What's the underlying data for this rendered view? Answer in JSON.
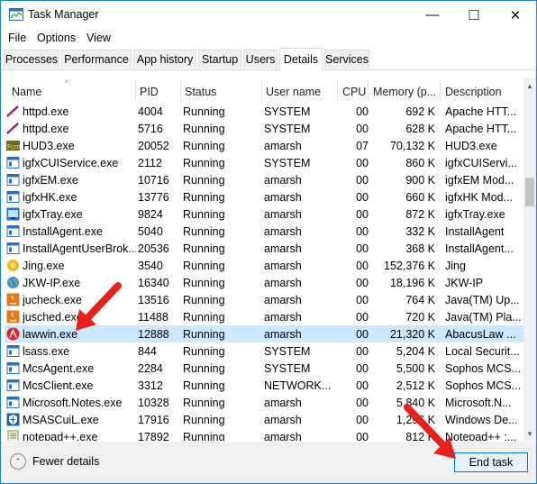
{
  "window": {
    "title": "Task Manager",
    "minimize_glyph": "—",
    "maximize_glyph": "☐",
    "close_glyph": "✕"
  },
  "menu": [
    "File",
    "Options",
    "View"
  ],
  "tabs": [
    "Processes",
    "Performance",
    "App history",
    "Startup",
    "Users",
    "Details",
    "Services"
  ],
  "active_tab": "Details",
  "columns": [
    "Name",
    "PID",
    "Status",
    "User name",
    "CPU",
    "Memory (p...",
    "Description"
  ],
  "sort_indicator": "^",
  "rows": [
    {
      "name": "httpd.exe",
      "pid": "4004",
      "status": "Running",
      "user": "SYSTEM",
      "cpu": "00",
      "mem": "692 K",
      "desc": "Apache HTT...",
      "icon": "feather-icon"
    },
    {
      "name": "httpd.exe",
      "pid": "5716",
      "status": "Running",
      "user": "SYSTEM",
      "cpu": "00",
      "mem": "628 K",
      "desc": "Apache HTT...",
      "icon": "feather-icon"
    },
    {
      "name": "HUD3.exe",
      "pid": "20052",
      "status": "Running",
      "user": "amarsh",
      "cpu": "07",
      "mem": "70,132 K",
      "desc": "HUD3.exe",
      "icon": "fcm-icon"
    },
    {
      "name": "igfxCUIService.exe",
      "pid": "2112",
      "status": "Running",
      "user": "SYSTEM",
      "cpu": "00",
      "mem": "860 K",
      "desc": "igfxCUIServi...",
      "icon": "app-window-icon"
    },
    {
      "name": "igfxEM.exe",
      "pid": "10716",
      "status": "Running",
      "user": "amarsh",
      "cpu": "00",
      "mem": "900 K",
      "desc": "igfxEM Mod...",
      "icon": "app-window-icon"
    },
    {
      "name": "igfxHK.exe",
      "pid": "13776",
      "status": "Running",
      "user": "amarsh",
      "cpu": "00",
      "mem": "660 K",
      "desc": "igfxHK Mod...",
      "icon": "app-window-icon"
    },
    {
      "name": "igfxTray.exe",
      "pid": "9824",
      "status": "Running",
      "user": "amarsh",
      "cpu": "00",
      "mem": "872 K",
      "desc": "igfxTray.exe",
      "icon": "intel-tray-icon"
    },
    {
      "name": "InstallAgent.exe",
      "pid": "5040",
      "status": "Running",
      "user": "amarsh",
      "cpu": "00",
      "mem": "332 K",
      "desc": "InstallAgent",
      "icon": "app-window-icon"
    },
    {
      "name": "InstallAgentUserBrok...",
      "pid": "20536",
      "status": "Running",
      "user": "amarsh",
      "cpu": "00",
      "mem": "368 K",
      "desc": "InstallAgent...",
      "icon": "app-window-icon"
    },
    {
      "name": "Jing.exe",
      "pid": "3540",
      "status": "Running",
      "user": "amarsh",
      "cpu": "00",
      "mem": "152,376 K",
      "desc": "Jing",
      "icon": "jing-sun-icon"
    },
    {
      "name": "JKW-IP.exe",
      "pid": "16340",
      "status": "Running",
      "user": "amarsh",
      "cpu": "00",
      "mem": "18,196 K",
      "desc": "JKW-IP",
      "icon": "globe-icon"
    },
    {
      "name": "jucheck.exe",
      "pid": "13516",
      "status": "Running",
      "user": "amarsh",
      "cpu": "00",
      "mem": "764 K",
      "desc": "Java(TM) Up...",
      "icon": "java-icon"
    },
    {
      "name": "jusched.exe",
      "pid": "11488",
      "status": "Running",
      "user": "amarsh",
      "cpu": "00",
      "mem": "720 K",
      "desc": "Java(TM) Pla...",
      "icon": "java-icon"
    },
    {
      "name": "lawwin.exe",
      "pid": "12888",
      "status": "Running",
      "user": "amarsh",
      "cpu": "00",
      "mem": "21,320 K",
      "desc": "AbacusLaw ...",
      "icon": "abacus-icon",
      "selected": true
    },
    {
      "name": "lsass.exe",
      "pid": "844",
      "status": "Running",
      "user": "SYSTEM",
      "cpu": "00",
      "mem": "5,204 K",
      "desc": "Local Securit...",
      "icon": "app-window-icon"
    },
    {
      "name": "McsAgent.exe",
      "pid": "2284",
      "status": "Running",
      "user": "SYSTEM",
      "cpu": "00",
      "mem": "5,500 K",
      "desc": "Sophos MCS...",
      "icon": "app-window-icon"
    },
    {
      "name": "McsClient.exe",
      "pid": "3312",
      "status": "Running",
      "user": "NETWORK...",
      "cpu": "00",
      "mem": "2,512 K",
      "desc": "Sophos MCS...",
      "icon": "app-window-icon"
    },
    {
      "name": "Microsoft.Notes.exe",
      "pid": "10328",
      "status": "Running",
      "user": "amarsh",
      "cpu": "00",
      "mem": "5,840 K",
      "desc": "Microsoft.N...",
      "icon": "app-window-icon"
    },
    {
      "name": "MSASCuiL.exe",
      "pid": "17916",
      "status": "Running",
      "user": "amarsh",
      "cpu": "00",
      "mem": "1,296 K",
      "desc": "Windows De...",
      "icon": "defender-shield-icon"
    },
    {
      "name": "notepad++.exe",
      "pid": "17892",
      "status": "Running",
      "user": "amarsh",
      "cpu": "00",
      "mem": "812 K",
      "desc": "Notepad++ :...",
      "icon": "notepad-icon"
    }
  ],
  "footer": {
    "fewer_details": "Fewer details",
    "fewer_icon_glyph": "⌃",
    "end_task": "End task"
  },
  "scrollbar": {
    "up_glyph": "▲",
    "down_glyph": "▼"
  },
  "colors": {
    "accent": "#0078d7",
    "selection": "#cce8ff",
    "annotation": "#e8201a"
  }
}
